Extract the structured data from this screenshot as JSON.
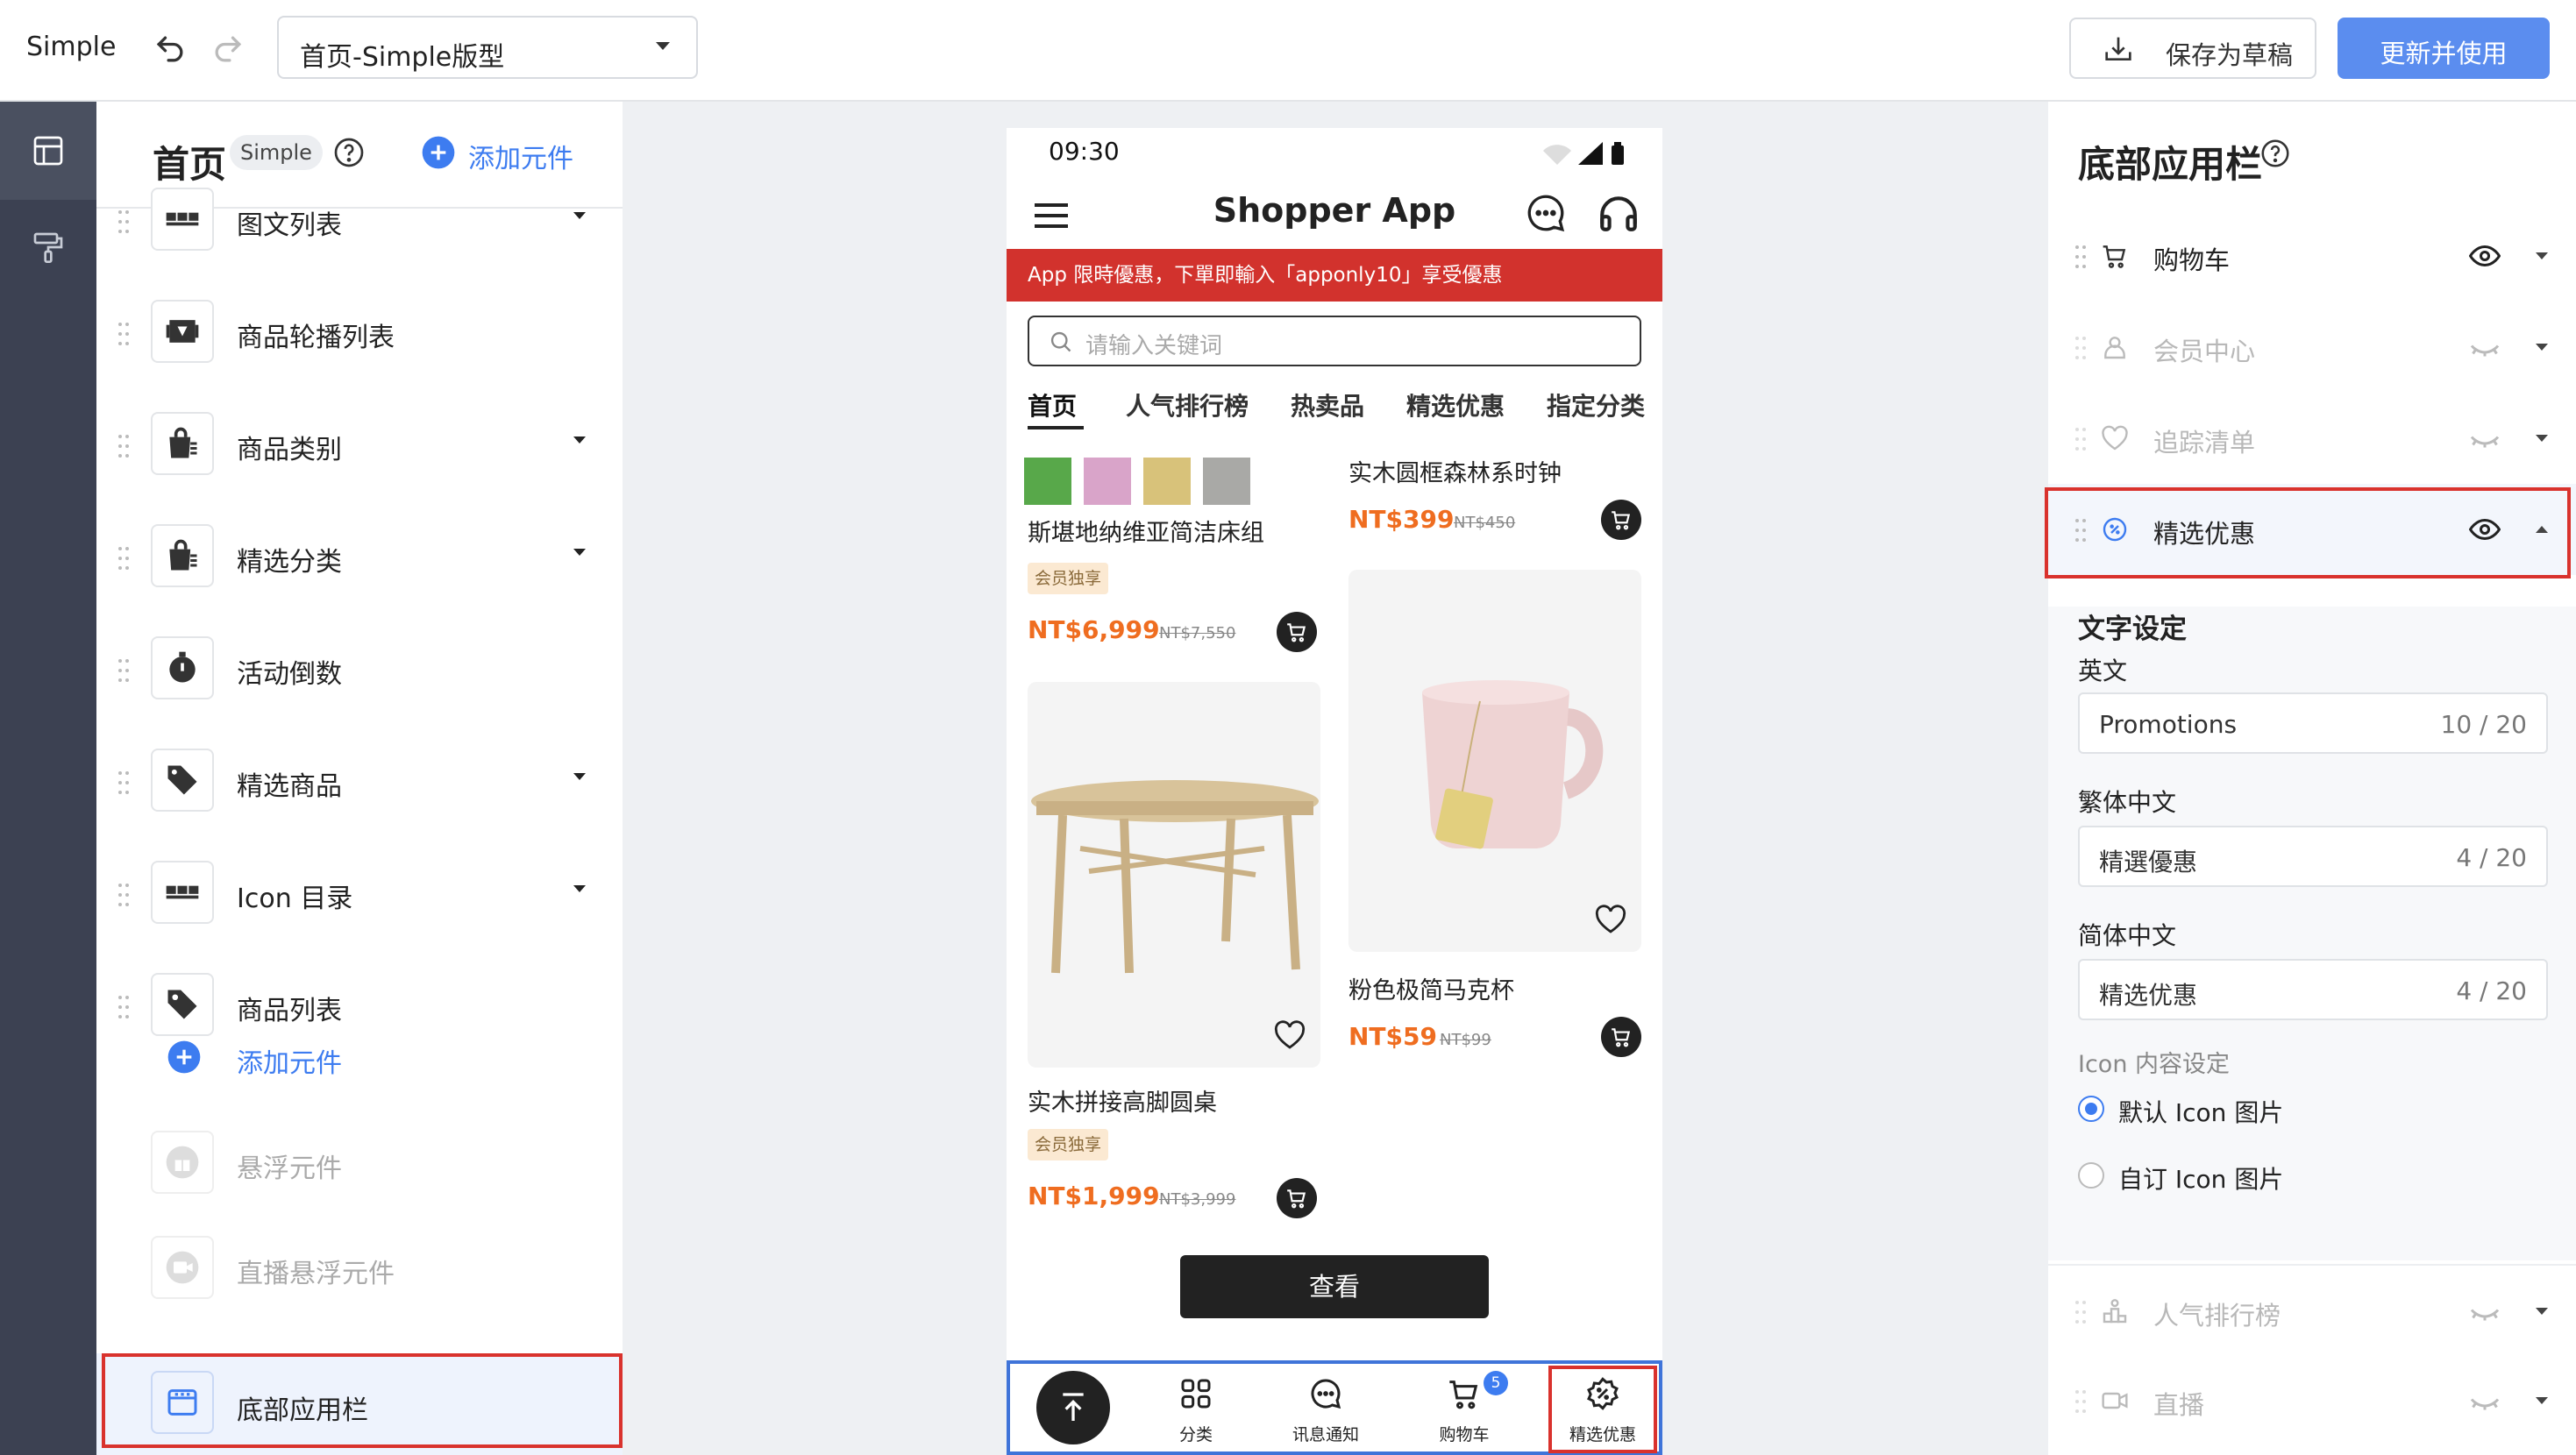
{
  "topbar": {
    "app_title": "Simple",
    "page_select": "首页-Simple版型",
    "save_draft": "保存为草稿",
    "update": "更新并使用"
  },
  "left_panel": {
    "title": "首页",
    "badge": "Simple",
    "add_component": "添加元件",
    "components": [
      {
        "label": "图文列表",
        "icon": "grid-icon",
        "expandable": true
      },
      {
        "label": "商品轮播列表",
        "icon": "carousel-icon",
        "expandable": false
      },
      {
        "label": "商品类别",
        "icon": "shopping-bag-icon",
        "expandable": true
      },
      {
        "label": "精选分类",
        "icon": "shopping-bag-icon",
        "expandable": true
      },
      {
        "label": "活动倒数",
        "icon": "stopwatch-icon",
        "expandable": false
      },
      {
        "label": "精选商品",
        "icon": "tags-icon",
        "expandable": true
      },
      {
        "label": "Icon 目录",
        "icon": "grid-icon",
        "expandable": true
      },
      {
        "label": "商品列表",
        "icon": "tag-icon",
        "expandable": false
      }
    ],
    "add_component_bottom": "添加元件",
    "floating": "悬浮元件",
    "live_floating": "直播悬浮元件",
    "bottom_bar": "底部应用栏"
  },
  "phone": {
    "time": "09:30",
    "app_name": "Shopper App",
    "promo_banner": "App 限時優惠，下單即輸入「apponly10」享受優惠",
    "search_placeholder": "请输入关键词",
    "tabs": [
      "首页",
      "人气排行榜",
      "热卖品",
      "精选优惠",
      "指定分类"
    ],
    "products": [
      {
        "title": "斯堪地纳维亚简洁床组",
        "tag": "会员独享",
        "price": "NT$6,999",
        "original": "NT$7,550"
      },
      {
        "title": "实木圆框森林系时钟",
        "price": "NT$399",
        "original": "NT$450"
      },
      {
        "title": "粉色极简马克杯",
        "price": "NT$59",
        "original": "NT$99"
      },
      {
        "title": "实木拼接高脚圆桌",
        "tag": "会员独享",
        "price": "NT$1,999",
        "original": "NT$3,999"
      }
    ],
    "swatch_colors": [
      "#58a84a",
      "#d9a4c9",
      "#d8c27a",
      "#a9a9a6"
    ],
    "view_button": "查看",
    "tabbar": {
      "category": "分类",
      "messages": "讯息通知",
      "cart": "购物车",
      "cart_badge": "5",
      "promotions": "精选优惠"
    }
  },
  "right_panel": {
    "title": "底部应用栏",
    "items": [
      {
        "label": "购物车",
        "visible": true
      },
      {
        "label": "会员中心",
        "visible": false
      },
      {
        "label": "追踪清单",
        "visible": false
      },
      {
        "label": "精选优惠",
        "visible": true
      }
    ],
    "text_settings": {
      "heading": "文字设定",
      "en_label": "英文",
      "en_value": "Promotions",
      "en_count": "10 / 20",
      "tc_label": "繁体中文",
      "tc_value": "精選優惠",
      "tc_count": "4 / 20",
      "sc_label": "简体中文",
      "sc_value": "精选优惠",
      "sc_count": "4 / 20"
    },
    "icon_settings": {
      "heading": "Icon 内容设定",
      "default": "默认 Icon 图片",
      "custom": "自订 Icon 图片",
      "selected": "default"
    },
    "more_items": [
      {
        "label": "人气排行榜",
        "visible": false
      },
      {
        "label": "直播",
        "visible": false
      }
    ]
  },
  "colors": {
    "accent": "#3d7cf0",
    "primary_button": "#5b8def",
    "promo_banner": "#d2322d",
    "price": "#ef6d20",
    "highlight_border": "#d9322d",
    "rail": "#3c4152"
  }
}
